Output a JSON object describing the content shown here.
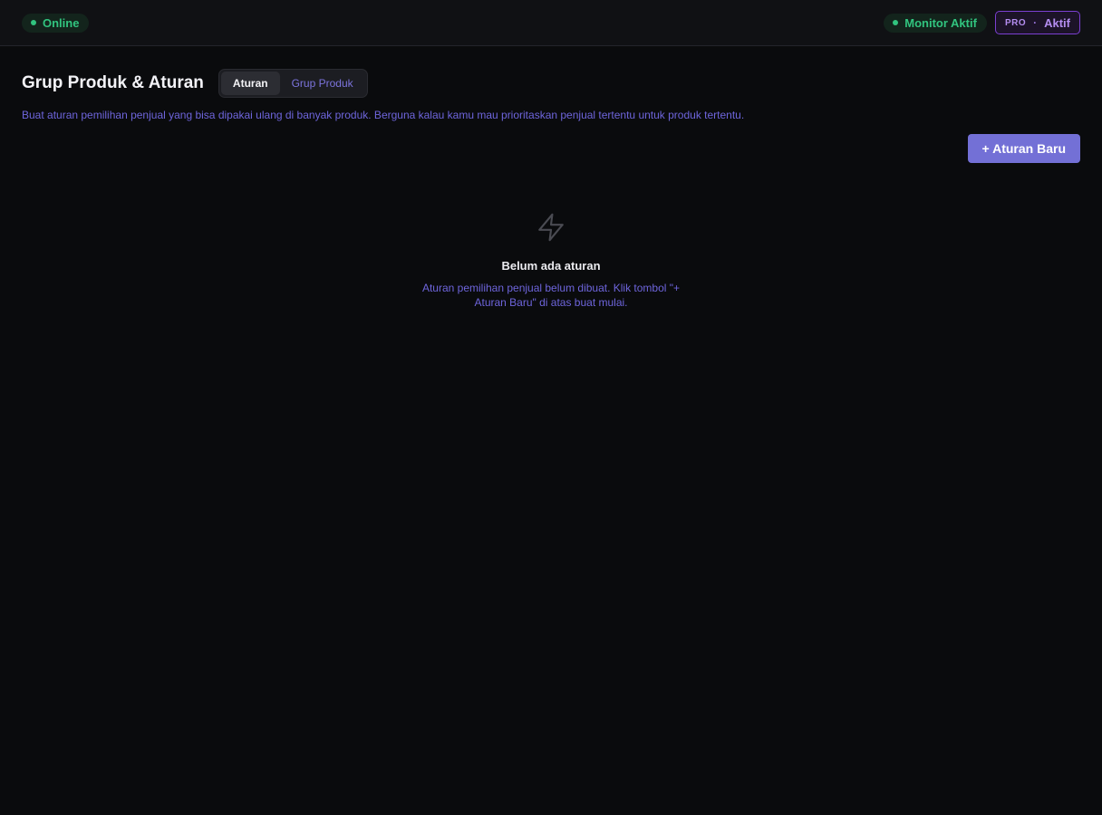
{
  "topbar": {
    "status_label": "Online",
    "monitor_label": "Monitor Aktif",
    "plan_name": "PRO",
    "plan_separator": "·",
    "plan_status": "Aktif"
  },
  "header": {
    "title": "Grup Produk & Aturan",
    "tabs": [
      {
        "label": "Aturan",
        "active": true
      },
      {
        "label": "Grup Produk",
        "active": false
      }
    ],
    "subtitle": "Buat aturan pemilihan penjual yang bisa dipakai ulang di banyak produk. Berguna kalau kamu mau prioritaskan penjual tertentu untuk produk tertentu."
  },
  "actions": {
    "new_rule_label": "+ Aturan Baru"
  },
  "empty_state": {
    "icon": "lightning-icon",
    "title": "Belum ada aturan",
    "description": "Aturan pemilihan penjual belum dibuat. Klik tombol \"+ Aturan Baru\" di atas buat mulai."
  },
  "colors": {
    "background": "#0a0b0d",
    "accent": "#7370d6",
    "success": "#31c47f",
    "pro": "#b48df0"
  }
}
